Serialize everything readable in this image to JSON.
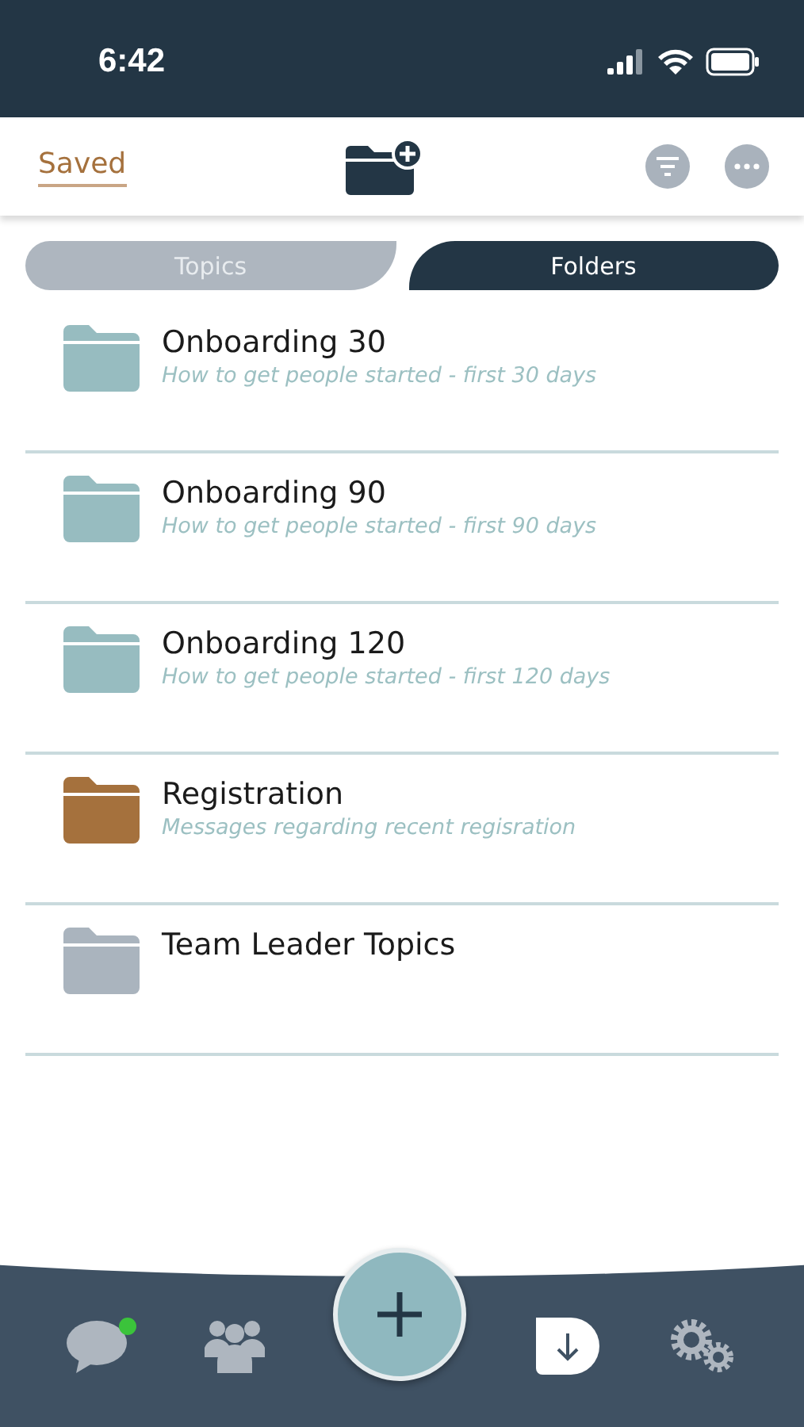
{
  "status_bar": {
    "time": "6:42"
  },
  "header": {
    "title": "Saved"
  },
  "tabs": [
    {
      "label": "Topics",
      "selected": false
    },
    {
      "label": "Folders",
      "selected": true
    }
  ],
  "folders": [
    {
      "name": "Onboarding 30",
      "description": "How to get people started - first 30 days",
      "color": "#97bcc0"
    },
    {
      "name": "Onboarding 90",
      "description": "How to get people started - first 90 days",
      "color": "#97bcc0"
    },
    {
      "name": "Onboarding 120",
      "description": "How to get people started - first 120 days",
      "color": "#97bcc0"
    },
    {
      "name": "Registration",
      "description": "Messages regarding recent regisration",
      "color": "#a5713d"
    },
    {
      "name": "Team Leader Topics",
      "color": "#aab4be"
    }
  ],
  "nav": [
    {
      "kind": "chat",
      "badge": true,
      "selected": false
    },
    {
      "kind": "people",
      "selected": false
    },
    {
      "kind": "add",
      "selected": false
    },
    {
      "kind": "saved",
      "selected": true
    },
    {
      "kind": "settings",
      "selected": false
    }
  ]
}
